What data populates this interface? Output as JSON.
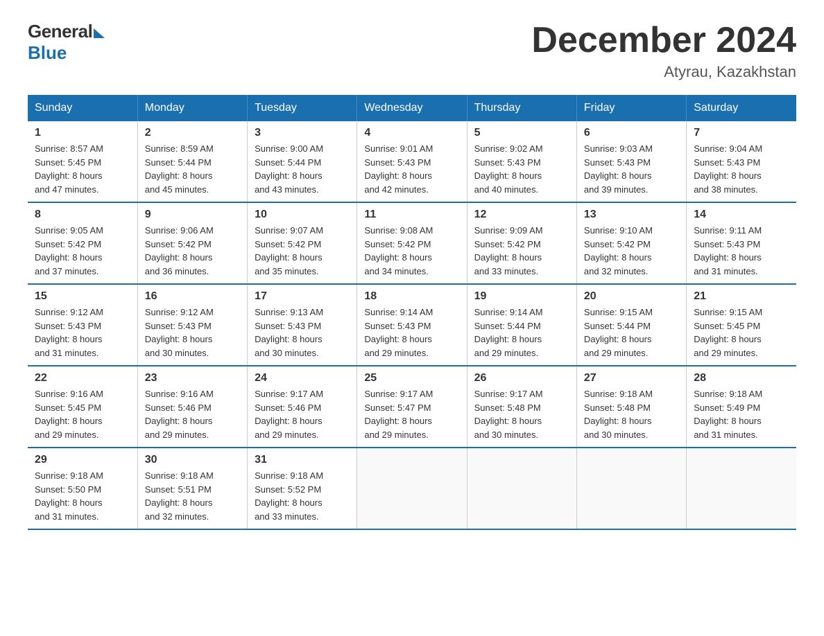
{
  "header": {
    "title": "December 2024",
    "location": "Atyrau, Kazakhstan",
    "logo_general": "General",
    "logo_blue": "Blue"
  },
  "weekdays": [
    "Sunday",
    "Monday",
    "Tuesday",
    "Wednesday",
    "Thursday",
    "Friday",
    "Saturday"
  ],
  "weeks": [
    [
      {
        "day": "1",
        "sunrise": "8:57 AM",
        "sunset": "5:45 PM",
        "daylight": "8 hours and 47 minutes."
      },
      {
        "day": "2",
        "sunrise": "8:59 AM",
        "sunset": "5:44 PM",
        "daylight": "8 hours and 45 minutes."
      },
      {
        "day": "3",
        "sunrise": "9:00 AM",
        "sunset": "5:44 PM",
        "daylight": "8 hours and 43 minutes."
      },
      {
        "day": "4",
        "sunrise": "9:01 AM",
        "sunset": "5:43 PM",
        "daylight": "8 hours and 42 minutes."
      },
      {
        "day": "5",
        "sunrise": "9:02 AM",
        "sunset": "5:43 PM",
        "daylight": "8 hours and 40 minutes."
      },
      {
        "day": "6",
        "sunrise": "9:03 AM",
        "sunset": "5:43 PM",
        "daylight": "8 hours and 39 minutes."
      },
      {
        "day": "7",
        "sunrise": "9:04 AM",
        "sunset": "5:43 PM",
        "daylight": "8 hours and 38 minutes."
      }
    ],
    [
      {
        "day": "8",
        "sunrise": "9:05 AM",
        "sunset": "5:42 PM",
        "daylight": "8 hours and 37 minutes."
      },
      {
        "day": "9",
        "sunrise": "9:06 AM",
        "sunset": "5:42 PM",
        "daylight": "8 hours and 36 minutes."
      },
      {
        "day": "10",
        "sunrise": "9:07 AM",
        "sunset": "5:42 PM",
        "daylight": "8 hours and 35 minutes."
      },
      {
        "day": "11",
        "sunrise": "9:08 AM",
        "sunset": "5:42 PM",
        "daylight": "8 hours and 34 minutes."
      },
      {
        "day": "12",
        "sunrise": "9:09 AM",
        "sunset": "5:42 PM",
        "daylight": "8 hours and 33 minutes."
      },
      {
        "day": "13",
        "sunrise": "9:10 AM",
        "sunset": "5:42 PM",
        "daylight": "8 hours and 32 minutes."
      },
      {
        "day": "14",
        "sunrise": "9:11 AM",
        "sunset": "5:43 PM",
        "daylight": "8 hours and 31 minutes."
      }
    ],
    [
      {
        "day": "15",
        "sunrise": "9:12 AM",
        "sunset": "5:43 PM",
        "daylight": "8 hours and 31 minutes."
      },
      {
        "day": "16",
        "sunrise": "9:12 AM",
        "sunset": "5:43 PM",
        "daylight": "8 hours and 30 minutes."
      },
      {
        "day": "17",
        "sunrise": "9:13 AM",
        "sunset": "5:43 PM",
        "daylight": "8 hours and 30 minutes."
      },
      {
        "day": "18",
        "sunrise": "9:14 AM",
        "sunset": "5:43 PM",
        "daylight": "8 hours and 29 minutes."
      },
      {
        "day": "19",
        "sunrise": "9:14 AM",
        "sunset": "5:44 PM",
        "daylight": "8 hours and 29 minutes."
      },
      {
        "day": "20",
        "sunrise": "9:15 AM",
        "sunset": "5:44 PM",
        "daylight": "8 hours and 29 minutes."
      },
      {
        "day": "21",
        "sunrise": "9:15 AM",
        "sunset": "5:45 PM",
        "daylight": "8 hours and 29 minutes."
      }
    ],
    [
      {
        "day": "22",
        "sunrise": "9:16 AM",
        "sunset": "5:45 PM",
        "daylight": "8 hours and 29 minutes."
      },
      {
        "day": "23",
        "sunrise": "9:16 AM",
        "sunset": "5:46 PM",
        "daylight": "8 hours and 29 minutes."
      },
      {
        "day": "24",
        "sunrise": "9:17 AM",
        "sunset": "5:46 PM",
        "daylight": "8 hours and 29 minutes."
      },
      {
        "day": "25",
        "sunrise": "9:17 AM",
        "sunset": "5:47 PM",
        "daylight": "8 hours and 29 minutes."
      },
      {
        "day": "26",
        "sunrise": "9:17 AM",
        "sunset": "5:48 PM",
        "daylight": "8 hours and 30 minutes."
      },
      {
        "day": "27",
        "sunrise": "9:18 AM",
        "sunset": "5:48 PM",
        "daylight": "8 hours and 30 minutes."
      },
      {
        "day": "28",
        "sunrise": "9:18 AM",
        "sunset": "5:49 PM",
        "daylight": "8 hours and 31 minutes."
      }
    ],
    [
      {
        "day": "29",
        "sunrise": "9:18 AM",
        "sunset": "5:50 PM",
        "daylight": "8 hours and 31 minutes."
      },
      {
        "day": "30",
        "sunrise": "9:18 AM",
        "sunset": "5:51 PM",
        "daylight": "8 hours and 32 minutes."
      },
      {
        "day": "31",
        "sunrise": "9:18 AM",
        "sunset": "5:52 PM",
        "daylight": "8 hours and 33 minutes."
      },
      null,
      null,
      null,
      null
    ]
  ],
  "labels": {
    "sunrise": "Sunrise:",
    "sunset": "Sunset:",
    "daylight": "Daylight:"
  }
}
